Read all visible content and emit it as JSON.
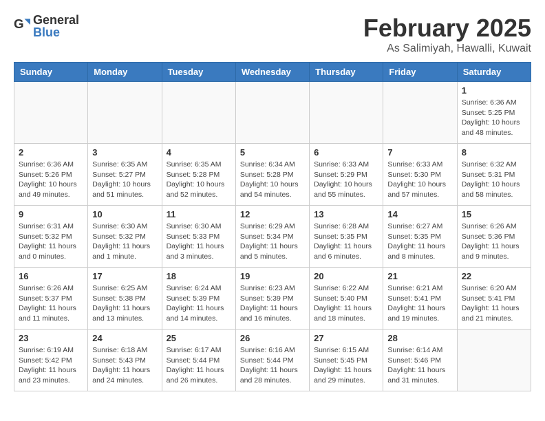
{
  "header": {
    "logo_general": "General",
    "logo_blue": "Blue",
    "title": "February 2025",
    "subtitle": "As Salimiyah, Hawalli, Kuwait"
  },
  "weekdays": [
    "Sunday",
    "Monday",
    "Tuesday",
    "Wednesday",
    "Thursday",
    "Friday",
    "Saturday"
  ],
  "weeks": [
    [
      {
        "day": "",
        "info": ""
      },
      {
        "day": "",
        "info": ""
      },
      {
        "day": "",
        "info": ""
      },
      {
        "day": "",
        "info": ""
      },
      {
        "day": "",
        "info": ""
      },
      {
        "day": "",
        "info": ""
      },
      {
        "day": "1",
        "info": "Sunrise: 6:36 AM\nSunset: 5:25 PM\nDaylight: 10 hours and 48 minutes."
      }
    ],
    [
      {
        "day": "2",
        "info": "Sunrise: 6:36 AM\nSunset: 5:26 PM\nDaylight: 10 hours and 49 minutes."
      },
      {
        "day": "3",
        "info": "Sunrise: 6:35 AM\nSunset: 5:27 PM\nDaylight: 10 hours and 51 minutes."
      },
      {
        "day": "4",
        "info": "Sunrise: 6:35 AM\nSunset: 5:28 PM\nDaylight: 10 hours and 52 minutes."
      },
      {
        "day": "5",
        "info": "Sunrise: 6:34 AM\nSunset: 5:28 PM\nDaylight: 10 hours and 54 minutes."
      },
      {
        "day": "6",
        "info": "Sunrise: 6:33 AM\nSunset: 5:29 PM\nDaylight: 10 hours and 55 minutes."
      },
      {
        "day": "7",
        "info": "Sunrise: 6:33 AM\nSunset: 5:30 PM\nDaylight: 10 hours and 57 minutes."
      },
      {
        "day": "8",
        "info": "Sunrise: 6:32 AM\nSunset: 5:31 PM\nDaylight: 10 hours and 58 minutes."
      }
    ],
    [
      {
        "day": "9",
        "info": "Sunrise: 6:31 AM\nSunset: 5:32 PM\nDaylight: 11 hours and 0 minutes."
      },
      {
        "day": "10",
        "info": "Sunrise: 6:30 AM\nSunset: 5:32 PM\nDaylight: 11 hours and 1 minute."
      },
      {
        "day": "11",
        "info": "Sunrise: 6:30 AM\nSunset: 5:33 PM\nDaylight: 11 hours and 3 minutes."
      },
      {
        "day": "12",
        "info": "Sunrise: 6:29 AM\nSunset: 5:34 PM\nDaylight: 11 hours and 5 minutes."
      },
      {
        "day": "13",
        "info": "Sunrise: 6:28 AM\nSunset: 5:35 PM\nDaylight: 11 hours and 6 minutes."
      },
      {
        "day": "14",
        "info": "Sunrise: 6:27 AM\nSunset: 5:35 PM\nDaylight: 11 hours and 8 minutes."
      },
      {
        "day": "15",
        "info": "Sunrise: 6:26 AM\nSunset: 5:36 PM\nDaylight: 11 hours and 9 minutes."
      }
    ],
    [
      {
        "day": "16",
        "info": "Sunrise: 6:26 AM\nSunset: 5:37 PM\nDaylight: 11 hours and 11 minutes."
      },
      {
        "day": "17",
        "info": "Sunrise: 6:25 AM\nSunset: 5:38 PM\nDaylight: 11 hours and 13 minutes."
      },
      {
        "day": "18",
        "info": "Sunrise: 6:24 AM\nSunset: 5:39 PM\nDaylight: 11 hours and 14 minutes."
      },
      {
        "day": "19",
        "info": "Sunrise: 6:23 AM\nSunset: 5:39 PM\nDaylight: 11 hours and 16 minutes."
      },
      {
        "day": "20",
        "info": "Sunrise: 6:22 AM\nSunset: 5:40 PM\nDaylight: 11 hours and 18 minutes."
      },
      {
        "day": "21",
        "info": "Sunrise: 6:21 AM\nSunset: 5:41 PM\nDaylight: 11 hours and 19 minutes."
      },
      {
        "day": "22",
        "info": "Sunrise: 6:20 AM\nSunset: 5:41 PM\nDaylight: 11 hours and 21 minutes."
      }
    ],
    [
      {
        "day": "23",
        "info": "Sunrise: 6:19 AM\nSunset: 5:42 PM\nDaylight: 11 hours and 23 minutes."
      },
      {
        "day": "24",
        "info": "Sunrise: 6:18 AM\nSunset: 5:43 PM\nDaylight: 11 hours and 24 minutes."
      },
      {
        "day": "25",
        "info": "Sunrise: 6:17 AM\nSunset: 5:44 PM\nDaylight: 11 hours and 26 minutes."
      },
      {
        "day": "26",
        "info": "Sunrise: 6:16 AM\nSunset: 5:44 PM\nDaylight: 11 hours and 28 minutes."
      },
      {
        "day": "27",
        "info": "Sunrise: 6:15 AM\nSunset: 5:45 PM\nDaylight: 11 hours and 29 minutes."
      },
      {
        "day": "28",
        "info": "Sunrise: 6:14 AM\nSunset: 5:46 PM\nDaylight: 11 hours and 31 minutes."
      },
      {
        "day": "",
        "info": ""
      }
    ]
  ]
}
